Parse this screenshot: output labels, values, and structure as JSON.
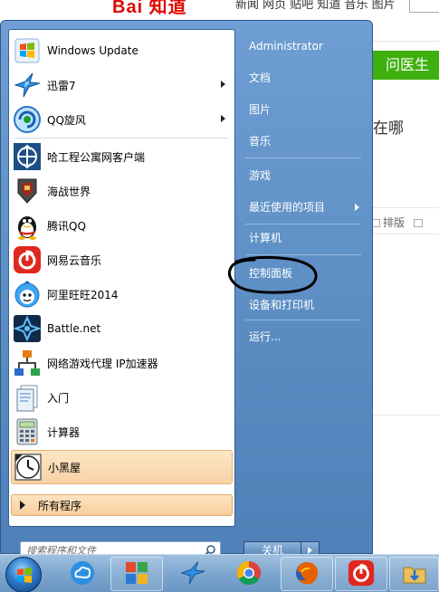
{
  "background": {
    "logo_text": "Bai 知道",
    "nav_text": "新闻  网页  贴吧  知道  音乐  图片",
    "green_tab": "问医生",
    "question_text": "在哪",
    "tools_text": "排版"
  },
  "start_menu": {
    "pinned": [
      {
        "label": "Windows Update",
        "icon": "windows-update-icon",
        "has_arrow": false
      },
      {
        "label": "迅雷7",
        "icon": "xunlei-bird-icon",
        "has_arrow": true
      },
      {
        "label": "QQ旋风",
        "icon": "qq-whirlwind-icon",
        "has_arrow": true
      }
    ],
    "recent": [
      {
        "label": "哈工程公寓网客户端",
        "icon": "network-client-icon"
      },
      {
        "label": "海战世界",
        "icon": "warship-icon"
      },
      {
        "label": "腾讯QQ",
        "icon": "qq-penguin-icon"
      },
      {
        "label": "网易云音乐",
        "icon": "netease-music-icon"
      },
      {
        "label": "阿里旺旺2014",
        "icon": "aliwangwang-icon"
      },
      {
        "label": "Battle.net",
        "icon": "battlenet-icon"
      },
      {
        "label": "网络游戏代理 IP加速器",
        "icon": "network-accelerator-icon"
      },
      {
        "label": "入门",
        "icon": "getting-started-icon"
      },
      {
        "label": "计算器",
        "icon": "calculator-icon"
      },
      {
        "label": "小黑屋",
        "icon": "clock-icon"
      }
    ],
    "all_programs": "所有程序",
    "search_placeholder": "搜索程序和文件",
    "right_items": [
      {
        "label": "Administrator",
        "has_arrow": false
      },
      {
        "label": "文档",
        "has_arrow": false
      },
      {
        "label": "图片",
        "has_arrow": false
      },
      {
        "label": "音乐",
        "has_arrow": false
      },
      {
        "label": "游戏",
        "has_arrow": false
      },
      {
        "label": "最近使用的项目",
        "has_arrow": true
      },
      {
        "label": "计算机",
        "has_arrow": false
      },
      {
        "label": "控制面板",
        "has_arrow": false
      },
      {
        "label": "设备和打印机",
        "has_arrow": false
      },
      {
        "label": "运行...",
        "has_arrow": false
      }
    ],
    "shutdown_label": "关机"
  },
  "taskbar": {
    "items": [
      "start-orb-icon",
      "cloud-sync-icon",
      "metro-tiles-icon",
      "xunlei-bird-icon",
      "chrome-icon",
      "firefox-icon",
      "netease-music-icon",
      "folder-download-icon"
    ]
  },
  "colors": {
    "menu_blue": "#5f93c8",
    "highlight_orange": "#f8d2a5",
    "baidu_red": "#e10602",
    "green_tab": "#3eaf0e"
  }
}
